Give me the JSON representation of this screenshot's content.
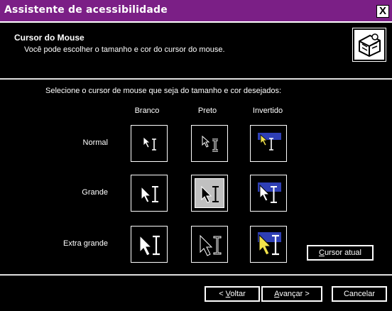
{
  "window": {
    "title": "Assistente de acessibilidade",
    "close_label": "X"
  },
  "header": {
    "title": "Cursor do Mouse",
    "description": "Você pode escolher o tamanho e cor do cursor do mouse."
  },
  "instruction": "Selecione o cursor de mouse que seja do tamanho e cor desejados:",
  "columns": [
    "Branco",
    "Preto",
    "Invertido"
  ],
  "rows": [
    "Normal",
    "Grande",
    "Extra grande"
  ],
  "selected": {
    "row": "Grande",
    "column": "Preto"
  },
  "buttons": {
    "current_cursor": {
      "accel": "C",
      "rest": "ursor atual"
    },
    "back": {
      "pre": "< ",
      "accel": "V",
      "rest": "oltar"
    },
    "next": {
      "accel": "A",
      "rest": "vançar >"
    },
    "cancel": "Cancelar"
  },
  "colors": {
    "titlebar": "#7b1f86",
    "background": "#000000",
    "inverted_fill": "#2e3fb5",
    "inverted_arrow": "#f2e24a"
  }
}
